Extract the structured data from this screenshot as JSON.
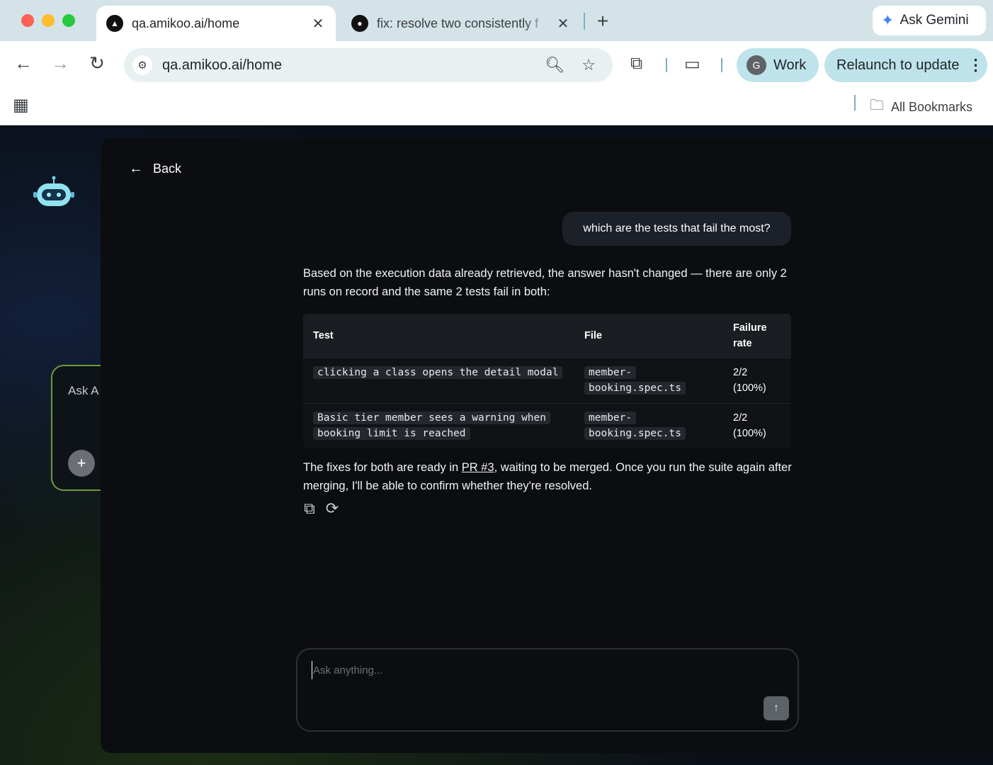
{
  "browser": {
    "tabs": [
      {
        "title": "qa.amikoo.ai/home",
        "active": true,
        "favicon": "triangle-logo-icon"
      },
      {
        "title": "fix: resolve two consistently f",
        "active": false,
        "favicon": "github-icon"
      }
    ],
    "gemini_label": "Ask Gemini",
    "url_host": "qa.amikoo.ai",
    "url_path": "/home",
    "profile_initial": "G",
    "profile_label": "Work",
    "relaunch_label": "Relaunch to update",
    "bookmarks_label": "All Bookmarks"
  },
  "sidebar": {
    "ask_card_text": "Ask A"
  },
  "chat": {
    "back_label": "Back",
    "user_message": "which are the tests that fail the most?",
    "answer_intro": "Based on the execution data already retrieved, the answer hasn't changed — there are only 2 runs on record and the same 2 tests fail in both:",
    "table": {
      "headers": [
        "Test",
        "File",
        "Failure rate"
      ],
      "rows": [
        {
          "test": "clicking a class opens the detail modal",
          "file": "member-booking.spec.ts",
          "rate_frac": "2/2",
          "rate_pct": "(100%)"
        },
        {
          "test": "Basic tier member sees a warning when booking limit is reached",
          "file": "member-booking.spec.ts",
          "rate_frac": "2/2",
          "rate_pct": "(100%)"
        }
      ]
    },
    "followup_before": "The fixes for both are ready in ",
    "followup_link": "PR #3",
    "followup_after": ", waiting to be merged. Once you run the suite again after merging, I'll be able to confirm whether they're resolved.",
    "composer_placeholder": "Ask anything..."
  },
  "colors": {
    "panel_bg": "#0c0d10",
    "accent_green": "#6c9b3a",
    "chrome_tab_strip": "#d3e3e8"
  }
}
